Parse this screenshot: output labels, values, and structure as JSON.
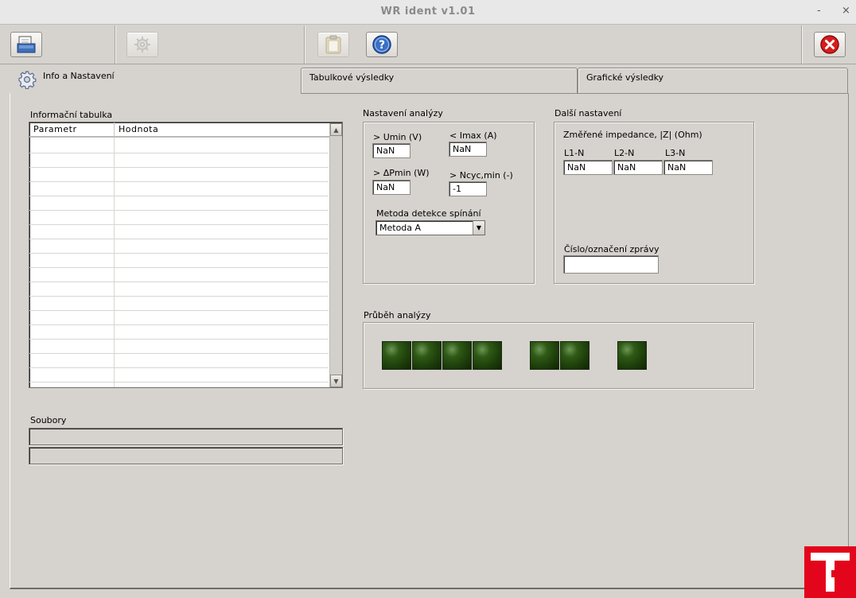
{
  "window": {
    "title": "WR ident v1.01",
    "minimize_label": "-",
    "close_label": "×"
  },
  "toolbar": {
    "buttons": [
      {
        "name": "open-icon",
        "enabled": true
      },
      {
        "name": "gear-icon",
        "enabled": false
      },
      {
        "name": "clipboard-icon",
        "enabled": false
      },
      {
        "name": "help-icon",
        "enabled": true
      },
      {
        "name": "close-icon",
        "enabled": true
      }
    ]
  },
  "tabs": [
    {
      "label": "Info a Nastavení",
      "active": true
    },
    {
      "label": "Tabulkové výsledky",
      "active": false
    },
    {
      "label": "Grafické výsledky",
      "active": false
    }
  ],
  "info_table": {
    "title": "Informační tabulka",
    "columns": [
      "Parametr",
      "Hodnota"
    ],
    "rows": []
  },
  "files": {
    "title": "Soubory",
    "file1": "",
    "file2": ""
  },
  "analysis_settings": {
    "title": "Nastavení analýzy",
    "umin_label": "> Umin (V)",
    "umin_value": "NaN",
    "imax_label": "< Imax (A)",
    "imax_value": "NaN",
    "pmin_label": "> ΔPmin (W)",
    "pmin_value": "NaN",
    "ncyc_label": "> Ncyc,min (-)",
    "ncyc_value": "-1",
    "method_label": "Metoda detekce spínání",
    "method_value": "Metoda A"
  },
  "other_settings": {
    "title": "Další nastavení",
    "impedance_label": "Změřené impedance, |Z| (Ohm)",
    "l1_label": "L1-N",
    "l1_value": "NaN",
    "l2_label": "L2-N",
    "l2_value": "NaN",
    "l3_label": "L3-N",
    "l3_value": "NaN",
    "report_label": "Číslo/označení zprávy",
    "report_value": ""
  },
  "progress": {
    "title": "Průběh analýzy",
    "led_count": 7,
    "led_color": "#1d3d0a"
  },
  "colors": {
    "logo": "#e3051b",
    "background": "#d6d3ce"
  }
}
